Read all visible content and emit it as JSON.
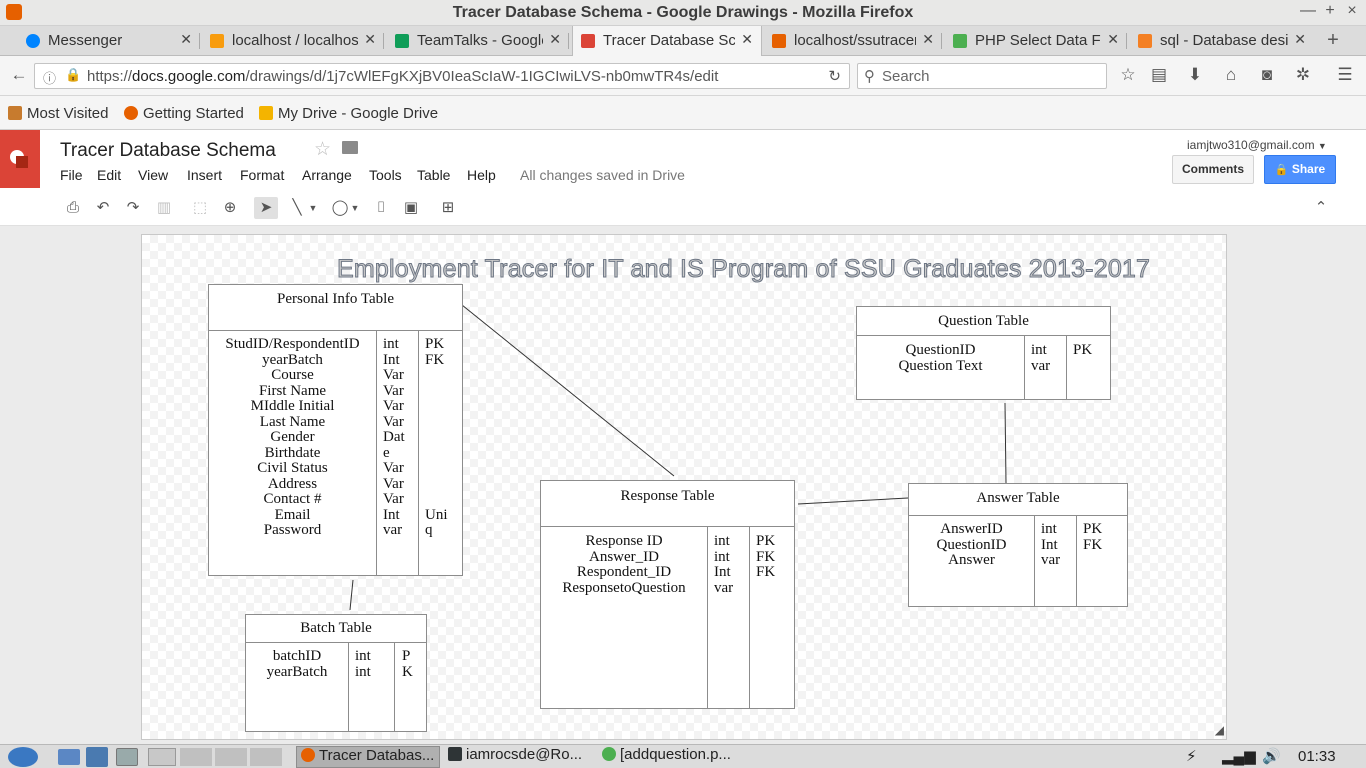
{
  "window": {
    "title": "Tracer Database Schema - Google Drawings - Mozilla Firefox",
    "minimize": "—",
    "maximize": "+",
    "close": "×"
  },
  "tabs": [
    {
      "label": "Messenger",
      "color": "#0084ff",
      "active": false
    },
    {
      "label": "localhost / localhost",
      "color": "#f89c0e",
      "active": false
    },
    {
      "label": "TeamTalks - Google",
      "color": "#0f9d58",
      "active": false
    },
    {
      "label": "Tracer Database Schema",
      "color": "#db4437",
      "active": true
    },
    {
      "label": "localhost/ssutracer",
      "color": "#e66000",
      "active": false
    },
    {
      "label": "PHP Select Data From",
      "color": "#4caf50",
      "active": false
    },
    {
      "label": "sql - Database design",
      "color": "#f48024",
      "active": false
    }
  ],
  "nav": {
    "url_prefix": "https://",
    "url_host": "docs.google.com",
    "url_path": "/drawings/d/1j7cWlEFgKXjBV0IeaScIaW-1IGCIwiLVS-nb0mwTR4s/edit",
    "search_placeholder": "Search"
  },
  "bookmarks": [
    {
      "label": "Most Visited",
      "color": "#c77b2e"
    },
    {
      "label": "Getting Started",
      "color": "#e66000"
    },
    {
      "label": "My Drive - Google Drive",
      "color": "#f4b400"
    }
  ],
  "doc": {
    "title": "Tracer Database Schema",
    "menu": [
      "File",
      "Edit",
      "View",
      "Insert",
      "Format",
      "Arrange",
      "Tools",
      "Table",
      "Help"
    ],
    "status": "All changes saved in Drive",
    "account": "iamjtwo310@gmail.com",
    "comments_label": "Comments",
    "share_label": "Share"
  },
  "drawing": {
    "title": "Employment Tracer for IT and IS Program of SSU Graduates 2013-2017",
    "tables": {
      "personal": {
        "name": "Personal Info Table",
        "fields": "StudID/RespondentID\nyearBatch\nCourse\nFirst Name\nMIddle Initial\nLast Name\nGender\nBirthdate\nCivil Status\nAddress\nContact #\nEmail\nPassword",
        "types": "int\nInt\nVar\nVar\nVar\nVar\nDat\ne\nVar\nVar\nVar\nInt\nvar",
        "keys": "PK\nFK\n\n\n\n\n\n\n\n\n\nUni\nq"
      },
      "batch": {
        "name": "Batch Table",
        "fields": "batchID\nyearBatch",
        "types": "int\nint",
        "keys": "P\nK"
      },
      "response": {
        "name": "Response Table",
        "fields": "Response ID\nAnswer_ID\nRespondent_ID\nResponsetoQuestion",
        "types": "int\nint\nInt\nvar",
        "keys": "PK\nFK\nFK"
      },
      "question": {
        "name": "Question Table",
        "fields": "QuestionID\nQuestion Text",
        "types": "int\nvar",
        "keys": "PK"
      },
      "answer": {
        "name": "Answer Table",
        "fields": "AnswerID\nQuestionID\nAnswer",
        "types": "int\nInt\nvar",
        "keys": "PK\nFK"
      }
    }
  },
  "taskbar": {
    "items": [
      {
        "label": "Tracer Databas...",
        "color": "#e66000",
        "active": true
      },
      {
        "label": "iamrocsde@Ro...",
        "color": "#2e3436",
        "active": false
      },
      {
        "label": "[addquestion.p...",
        "color": "#4caf50",
        "active": false
      }
    ],
    "clock": "01:33"
  }
}
